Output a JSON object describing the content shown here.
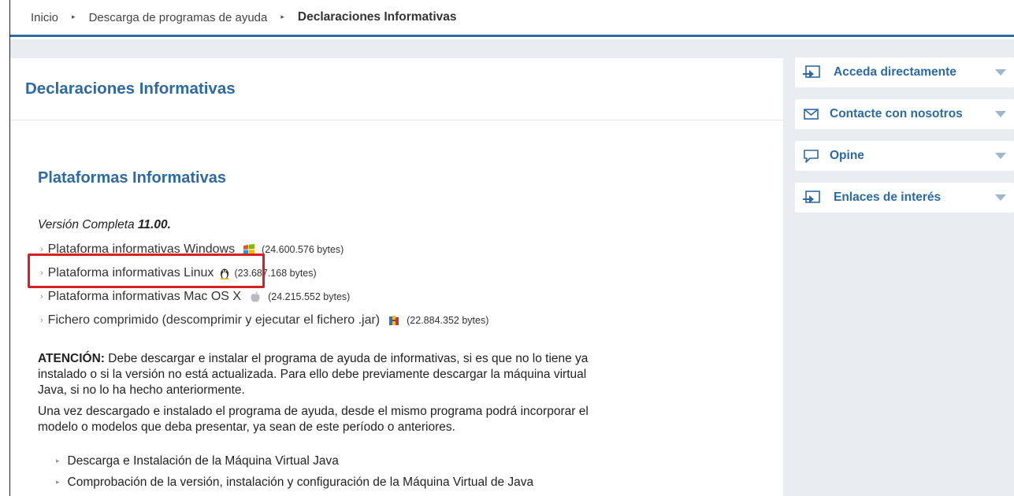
{
  "breadcrumb": {
    "items": [
      "Inicio",
      "Descarga de programas de ayuda"
    ],
    "current": "Declaraciones Informativas",
    "separator": "▸"
  },
  "main": {
    "page_title": "Declaraciones Informativas",
    "section_title": "Plataformas Informativas",
    "version_prefix": "Versión Completa ",
    "version_number": "11.00.",
    "downloads": [
      {
        "label": "Plataforma informativas Windows",
        "icon": "windows-icon",
        "size": "(24.600.576 bytes)"
      },
      {
        "label": "Plataforma informativas Linux",
        "icon": "linux-tux-icon",
        "size": "(23.687.168 bytes)"
      },
      {
        "label": "Plataforma informativas Mac OS X",
        "icon": "apple-icon",
        "size": "(24.215.552 bytes)"
      },
      {
        "label": "Fichero comprimido (descomprimir y ejecutar el fichero .jar)",
        "icon": "jar-icon",
        "size": "(22.884.352 bytes)"
      }
    ],
    "notice_label": "ATENCIÓN:",
    "notice_text": " Debe descargar e instalar el programa de ayuda de informativas, si es que no lo tiene ya instalado o si la versión no está actualizada. Para ello debe previamente descargar la máquina virtual Java, si no lo ha hecho anteriormente.",
    "notice2_text": "Una vez descargado e instalado el programa de ayuda, desde el mismo programa podrá incorporar el modelo o modelos que deba presentar, ya sean de este período o anteriores.",
    "java_links": [
      "Descarga e Instalación de la Máquina Virtual Java",
      "Comprobación de la versión, instalación y configuración de la Máquina Virtual de Java"
    ]
  },
  "sidebar": {
    "items": [
      {
        "label": "Acceda directamente",
        "icon": "direct-access-icon"
      },
      {
        "label": "Contacte con nosotros",
        "icon": "envelope-icon"
      },
      {
        "label": "Opine",
        "icon": "speech-bubble-icon"
      },
      {
        "label": "Enlaces de interés",
        "icon": "links-icon"
      }
    ]
  },
  "colors": {
    "accent": "#2b6aa6",
    "highlight": "#d81f26",
    "background": "#e9edf1"
  }
}
